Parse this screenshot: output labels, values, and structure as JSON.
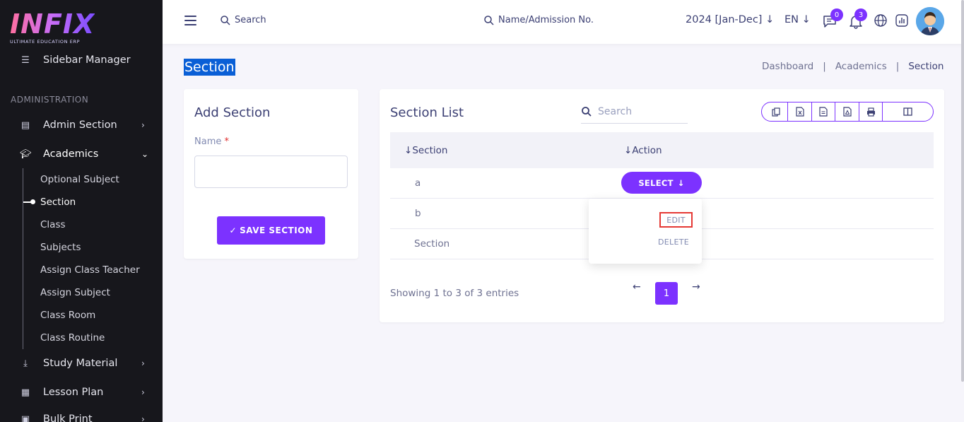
{
  "brand": {
    "logo": "INFIX",
    "tagline": "ULTIMATE EDUCATION ERP"
  },
  "sidebar": {
    "partial_item": "Sidebar Manager",
    "category": "ADMINISTRATION",
    "items": [
      {
        "label": "Admin Section",
        "icon": "admin-icon"
      },
      {
        "label": "Academics",
        "icon": "graduation-cap-icon"
      },
      {
        "label": "Study Material",
        "icon": "download-icon"
      },
      {
        "label": "Lesson Plan",
        "icon": "lesson-icon"
      },
      {
        "label": "Bulk Print",
        "icon": "print-icon"
      }
    ],
    "academics_sub": [
      "Optional Subject",
      "Section",
      "Class",
      "Subjects",
      "Assign Class Teacher",
      "Assign Subject",
      "Class Room",
      "Class Routine"
    ]
  },
  "header": {
    "search_label": "Search",
    "search2_label": "Name/Admission No.",
    "year": "2024 [Jan-Dec]",
    "lang": "EN",
    "message_count": "0",
    "notification_count": "3"
  },
  "page": {
    "title": "Section",
    "breadcrumb": [
      "Dashboard",
      "|",
      "Academics",
      "|",
      "Section"
    ]
  },
  "add_section": {
    "title": "Add Section",
    "name_label": "Name",
    "required_mark": "*",
    "save_label": "SAVE SECTION",
    "save_icon": "✓"
  },
  "section_list": {
    "title": "Section List",
    "search_placeholder": "Search",
    "columns": [
      "Section",
      "Action"
    ],
    "rows": [
      "a",
      "b",
      "Section"
    ],
    "select_label": "SELECT",
    "dropdown": {
      "edit": "EDIT",
      "delete": "DELETE"
    },
    "showing": "Showing 1 to 3 of 3 entries",
    "current_page": "1"
  },
  "colors": {
    "accent": "#7c32ff",
    "sidebar_bg": "#17171c",
    "text_dark": "#3b3f73"
  }
}
